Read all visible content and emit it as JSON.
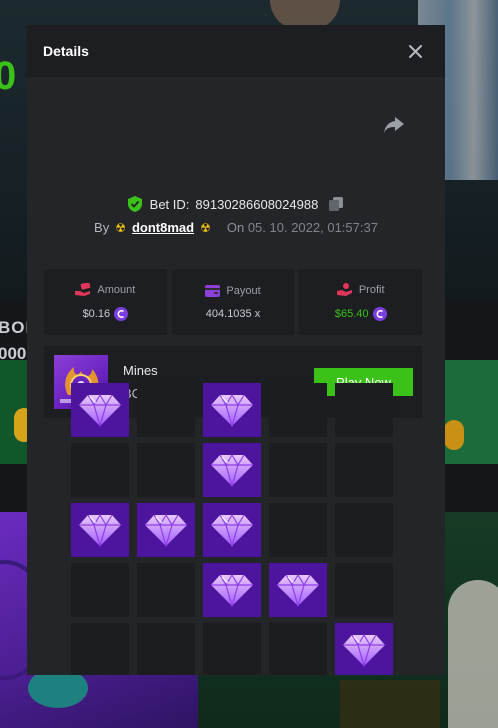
{
  "modal": {
    "title": "Details",
    "close_icon": "close-icon",
    "share_icon": "share-icon"
  },
  "bet": {
    "label": "Bet ID:",
    "id": "89130286608024988",
    "by_label": "By",
    "username": "dont8mad",
    "on_label": "On",
    "date": "05. 10. 2022, 01:57:37"
  },
  "stats": [
    {
      "label": "Amount",
      "value": "$0.16",
      "icon": "money-hand-icon",
      "has_coin": true
    },
    {
      "label": "Payout",
      "value": "404.1035 x",
      "icon": "wallet-icon",
      "has_coin": false
    },
    {
      "label": "Profit",
      "value": "$65.40",
      "icon": "profit-hand-icon",
      "has_coin": true
    }
  ],
  "game": {
    "name": "Mines",
    "subtitle": "BC Original",
    "button_label": "Play Now"
  },
  "board": {
    "rows": 5,
    "cols": 5,
    "cells": [
      [
        1,
        0,
        1,
        0,
        0
      ],
      [
        0,
        0,
        1,
        0,
        0
      ],
      [
        1,
        1,
        1,
        0,
        0
      ],
      [
        0,
        0,
        1,
        1,
        0
      ],
      [
        0,
        0,
        0,
        0,
        1
      ]
    ]
  },
  "colors": {
    "accent_green": "#3bc117",
    "gem_tile": "#4d159e",
    "empty_tile": "#1b1d20",
    "modal_bg": "#232528"
  }
}
